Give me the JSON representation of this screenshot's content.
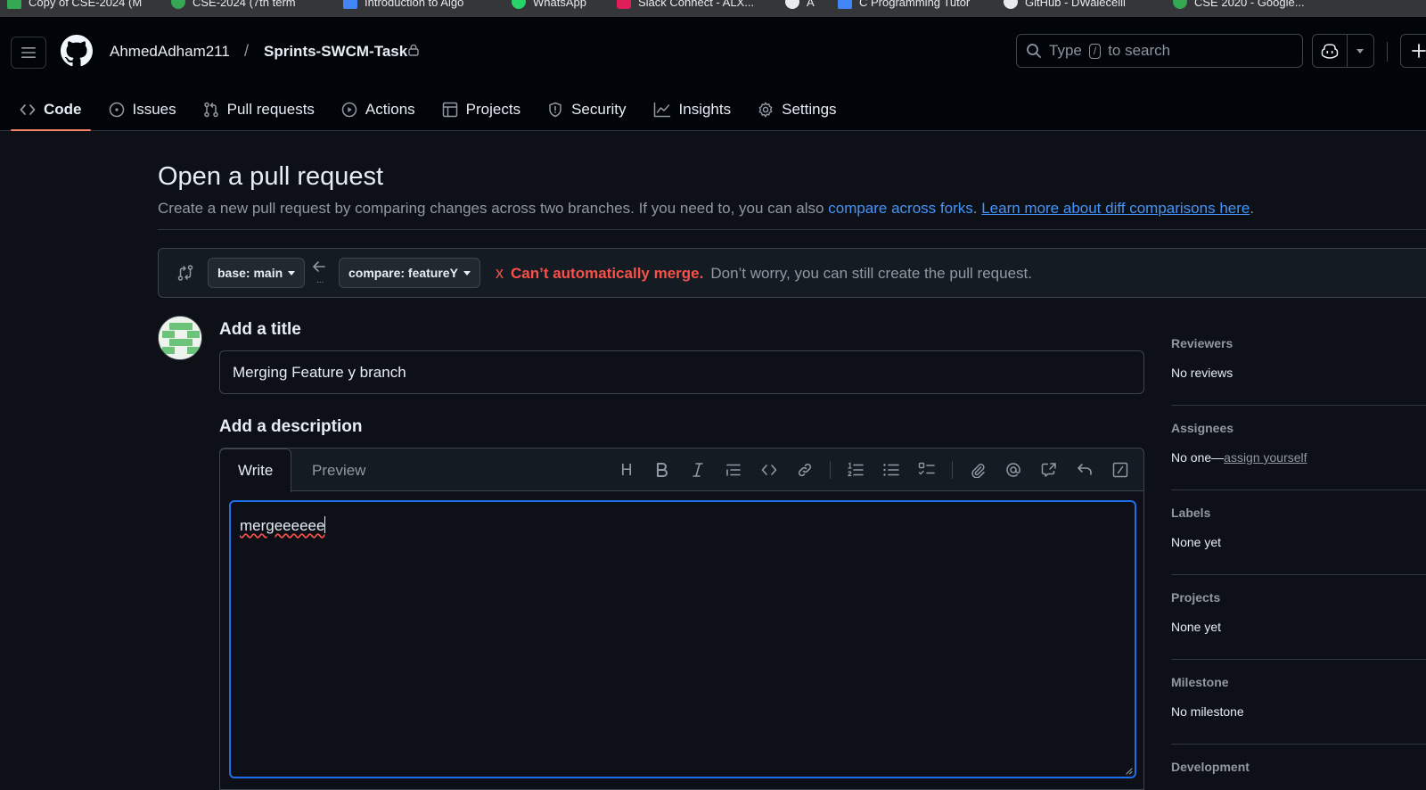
{
  "bookmarks": [
    {
      "label": "Copy of CSE-2024 (M",
      "color": "#34a853"
    },
    {
      "label": "CSE-2024 (7th term",
      "color": "#34a853"
    },
    {
      "label": "Introduction to Algo",
      "color": "#4285f4"
    },
    {
      "label": "WhatsApp",
      "color": "#25d366"
    },
    {
      "label": "Slack Connect - ALX...",
      "color": "#e01e5a"
    },
    {
      "label": "A",
      "color": "#e8eaed"
    },
    {
      "label": "C Programming Tutor",
      "color": "#4285f4"
    },
    {
      "label": "GitHub - DWalecelli",
      "color": "#e8eaed"
    },
    {
      "label": "CSE 2020 - Google...",
      "color": "#34a853"
    }
  ],
  "header": {
    "owner": "AhmedAdham211",
    "separator": "/",
    "repo": "Sprints-SWCM-Task",
    "search_placeholder": "Type",
    "search_key": "/",
    "search_suffix": "to search"
  },
  "tabs": [
    {
      "label": "Code",
      "icon": "code-icon",
      "active": true
    },
    {
      "label": "Issues",
      "icon": "issue-opened-icon"
    },
    {
      "label": "Pull requests",
      "icon": "git-pull-request-icon"
    },
    {
      "label": "Actions",
      "icon": "play-icon"
    },
    {
      "label": "Projects",
      "icon": "table-icon"
    },
    {
      "label": "Security",
      "icon": "shield-icon"
    },
    {
      "label": "Insights",
      "icon": "graph-icon"
    },
    {
      "label": "Settings",
      "icon": "gear-icon"
    }
  ],
  "page": {
    "title": "Open a pull request",
    "subtitle_text": "Create a new pull request by comparing changes across two branches. If you need to, you can also",
    "link1": "compare across forks",
    "sep": ".",
    "link2": "Learn more about diff comparisons here",
    "end": "."
  },
  "compare": {
    "base": "base: main",
    "head": "compare: featureY",
    "dots": "...",
    "status_icon": "x",
    "error": "Can’t automatically merge.",
    "note": "Don’t worry, you can still create the pull request."
  },
  "form": {
    "title_label": "Add a title",
    "title_value": "Merging Feature y branch",
    "desc_label": "Add a description",
    "write_tab": "Write",
    "preview_tab": "Preview",
    "body_value": "mergeeeeee",
    "heading_tool": "H"
  },
  "sidebar": [
    {
      "heading": "Reviewers",
      "value": "No reviews"
    },
    {
      "heading": "Assignees",
      "value": "No one—",
      "link": "assign yourself"
    },
    {
      "heading": "Labels",
      "value": "None yet"
    },
    {
      "heading": "Projects",
      "value": "None yet"
    },
    {
      "heading": "Milestone",
      "value": "No milestone"
    },
    {
      "heading": "Development",
      "value": ""
    }
  ],
  "colors": {
    "background": "#0d1117",
    "header": "#010409",
    "accent_link": "#4493f8",
    "danger": "#f85149",
    "tab_underline": "#f78166",
    "focus_border": "#1f6feb"
  }
}
